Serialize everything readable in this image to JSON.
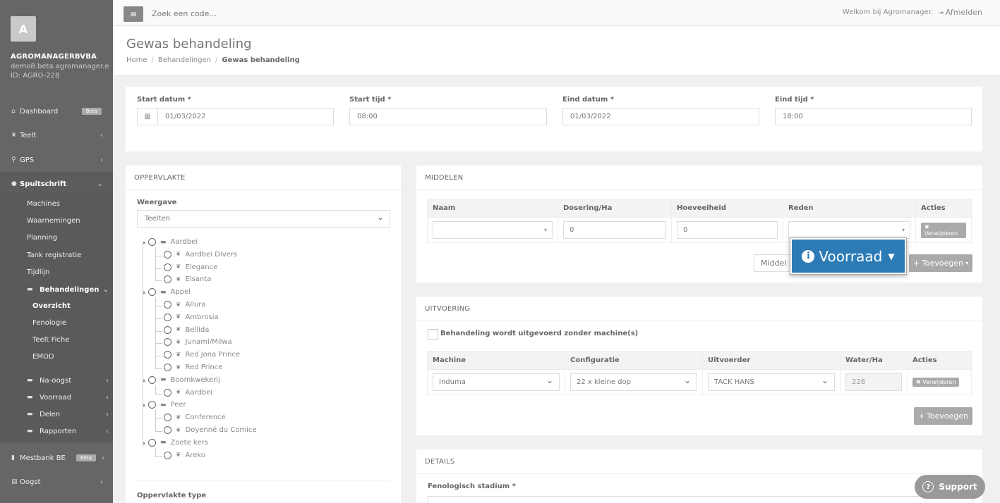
{
  "sidebar": {
    "avatar_letter": "A",
    "company": "AGROMANAGERBVBA",
    "domain": "demo8.beta.agromanager.e",
    "id": "ID: AGRO-228",
    "dashboard": "Dashboard",
    "dashboard_badge": "Beta",
    "teelt": "Teelt",
    "gps": "GPS",
    "spuitschrift": "Spuitschrift",
    "spuit_items": [
      "Machines",
      "Waarnemingen",
      "Planning",
      "Tank registratie",
      "Tijdlijn"
    ],
    "behandelingen": "Behandelingen",
    "behandel_items": [
      "Overzicht",
      "Fenologie",
      "Teelt Fiche",
      "EMOD"
    ],
    "na_oogst": "Na-oogst",
    "voorraad": "Voorraad",
    "delen": "Delen",
    "rapporten": "Rapporten",
    "mestbank": "Mestbank BE",
    "mestbank_badge": "Bèta",
    "oogst": "Oogst"
  },
  "topbar": {
    "search_placeholder": "Zoek een code...",
    "welcome": "Welkom bij Agromanager.",
    "logout": "Afmelden"
  },
  "header": {
    "title": "Gewas behandeling",
    "breadcrumb": [
      "Home",
      "Behandelingen",
      "Gewas behandeling"
    ]
  },
  "dates": {
    "start_datum_label": "Start datum *",
    "start_datum": "01/03/2022",
    "start_tijd_label": "Start tijd *",
    "start_tijd": "08:00",
    "eind_datum_label": "Eind datum *",
    "eind_datum": "01/03/2022",
    "eind_tijd_label": "Eind tijd *",
    "eind_tijd": "18:00"
  },
  "oppervlakte": {
    "title": "OPPERVLAKTE",
    "weergave_label": "Weergave",
    "weergave": "Teelten",
    "tree": [
      {
        "name": "Aardbei",
        "children": [
          "Aardbei Divers",
          "Elegance",
          "Elsanta"
        ]
      },
      {
        "name": "Appel",
        "children": [
          "Allura",
          "Ambrosia",
          "Bellida",
          "Junami/Milwa",
          "Red Jona Prince",
          "Red Prince"
        ]
      },
      {
        "name": "Boomkwekerij",
        "children": [
          "Aardbei"
        ]
      },
      {
        "name": "Peer",
        "children": [
          "Conference",
          "Doyenné du Comice"
        ]
      },
      {
        "name": "Zoete kers",
        "children": [
          "Areko"
        ]
      }
    ],
    "type_label": "Oppervlakte type"
  },
  "middelen": {
    "title": "MIDDELEN",
    "columns": [
      "Naam",
      "Dosering/Ha",
      "Hoeveelheid",
      "Reden",
      "Acties"
    ],
    "dosering": "0",
    "hoeveelheid": "0",
    "delete": "Verwijderen",
    "middel_btn": "Middel r",
    "add": "Toevoegen",
    "voorraad_btn": "Voorraad"
  },
  "uitvoering": {
    "title": "UITVOERING",
    "no_machine": "Behandeling wordt uitgevoerd zonder machine(s)",
    "columns": [
      "Machine",
      "Configuratie",
      "Uitvoerder",
      "Water/Ha",
      "Acties"
    ],
    "machine": "Induma",
    "configuratie": "22 x kleine dop",
    "uitvoerder": "TACK HANS",
    "water": "228",
    "delete": "Verwijderen",
    "add": "Toevoegen"
  },
  "details": {
    "title": "DETAILS",
    "fenologisch_label": "Fenologisch stadium *"
  },
  "support": "Support"
}
